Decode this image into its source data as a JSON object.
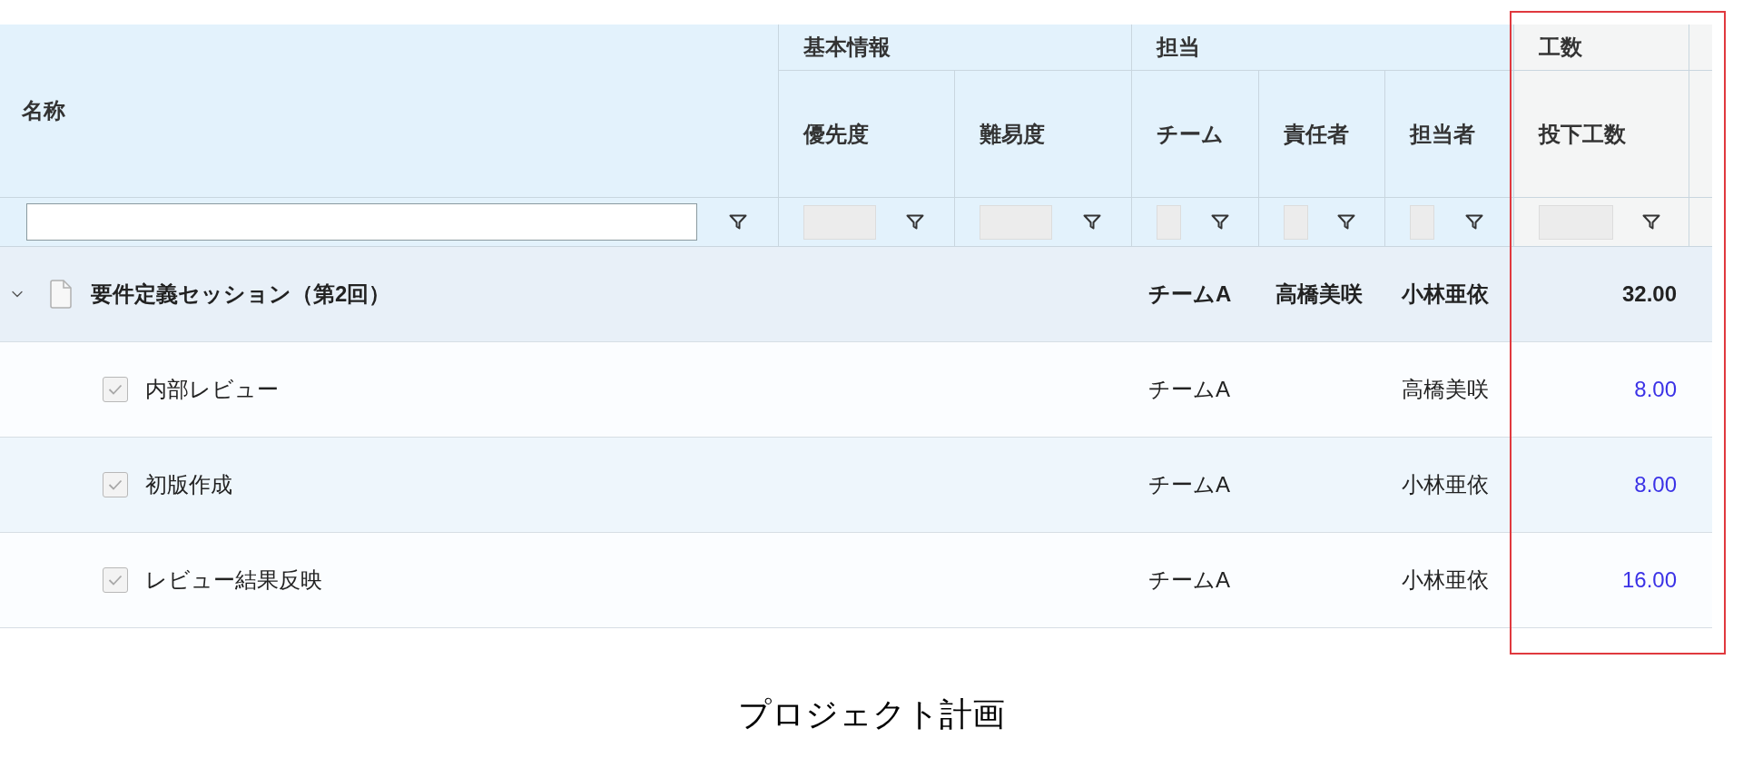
{
  "table": {
    "name_column": {
      "label": "名称",
      "filter_disabled": false
    },
    "column_groups": [
      {
        "label": "基本情報",
        "highlighted": false,
        "columns": [
          {
            "label": "優先度",
            "filter_disabled": true
          },
          {
            "label": "難易度",
            "filter_disabled": true
          }
        ]
      },
      {
        "label": "担当",
        "highlighted": false,
        "columns": [
          {
            "label": "チーム",
            "filter_disabled": true
          },
          {
            "label": "責任者",
            "filter_disabled": true
          },
          {
            "label": "担当者",
            "filter_disabled": true
          }
        ]
      },
      {
        "label": "工数",
        "highlighted": true,
        "columns": [
          {
            "label": "投下工数",
            "filter_disabled": true
          }
        ]
      }
    ],
    "rows": [
      {
        "name": "要件定義セッション（第2回）",
        "expanded": true,
        "team": "チームA",
        "owner": "高橋美咲",
        "assignee": "小林亜依",
        "effort": "32.00",
        "children": [
          {
            "name": "内部レビュー",
            "checked": true,
            "team": "チームA",
            "assignee": "高橋美咲",
            "effort": "8.00"
          },
          {
            "name": "初版作成",
            "checked": true,
            "team": "チームA",
            "assignee": "小林亜依",
            "effort": "8.00"
          },
          {
            "name": "レビュー結果反映",
            "checked": true,
            "team": "チームA",
            "assignee": "小林亜依",
            "effort": "16.00"
          }
        ]
      }
    ]
  },
  "caption": "プロジェクト計画"
}
